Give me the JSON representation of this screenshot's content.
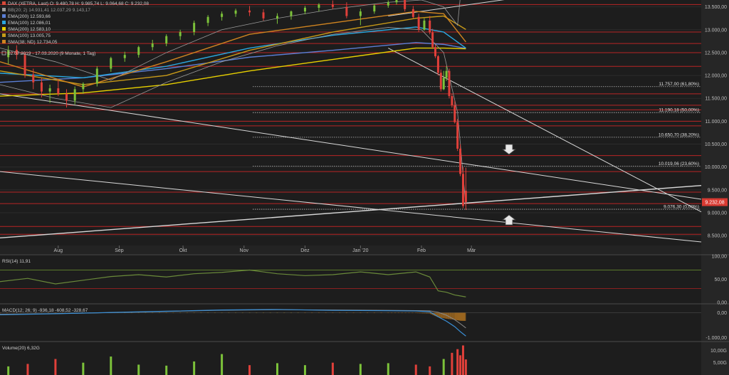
{
  "header": {
    "dax": "DAX (XETRA, Last)  O: 9.480,78  H: 9.985,74  L: 9.064,68  C: 9.232,08",
    "bb": "BB(20; 2)  14.931,41  12.037,29  9.143,17",
    "ema200": "EMA(200)  12.593,66",
    "ema100": "EMA(100)  12.086,01",
    "sma200": "SMA(200)  12.583,10",
    "sma100": "SMA(100)  13.005,75",
    "sma38": "SMA(38; ND)  12.734,05",
    "range": "02.07.2019 - 17.03.2020  (9 Monate, 1 Tag)"
  },
  "price_label": "9.232,08",
  "colors": {
    "up": "#7cc23a",
    "down": "#e0403a",
    "ema200": "#5b7fd6",
    "ema100": "#2aa8e0",
    "sma200": "#e8d000",
    "sma100": "#c89a18",
    "sma38": "#d08420",
    "bb": "#9a9a9a",
    "resistance": "#b82525",
    "trend": "#d8d8d8",
    "rsi": "#6a8a3a",
    "macd": "#3a8fd6",
    "signal": "#8a8a8a"
  },
  "fib_labels": [
    "11.757,00 (61,80%)",
    "11.190,18 (50,00%)",
    "10.650,70 (38,20%)",
    "10.019,06 (23,60%)",
    "9.076,30 (0,00%)"
  ],
  "rsi_header": "RSI(14)  11,91",
  "macd_header": "MACD(12; 26; 9)  -936,18  -608,52  -328,67",
  "vol_header": "Volume(20)  6,32G",
  "icons": {
    "down_arrow": "down-arrow-icon",
    "up_arrow": "up-arrow-icon"
  },
  "chart_data": [
    {
      "type": "candlestick",
      "name": "DAX (XETRA, Last)",
      "y_axis_ticks": [
        "13.500,00",
        "13.000,00",
        "12.500,00",
        "12.000,00",
        "11.500,00",
        "11.000,00",
        "10.500,00",
        "10.000,00",
        "9.500,00",
        "9.000,00",
        "8.500,00"
      ],
      "y_ticks": [
        13500,
        13000,
        12500,
        12000,
        11500,
        11000,
        10500,
        10000,
        9500,
        9000,
        8500
      ],
      "ylim": [
        8300,
        13650
      ],
      "x_axis_labels": [
        "Aug",
        "Sep",
        "Okt",
        "Nov",
        "Dez",
        "Jan '20",
        "Feb",
        "Mär"
      ],
      "x_label_index": [
        21,
        43,
        66,
        88,
        110,
        130,
        152,
        170
      ],
      "ohlc": [
        [
          12400,
          12650,
          12250,
          12550
        ],
        [
          12560,
          12660,
          12350,
          12450
        ],
        [
          12450,
          12500,
          11950,
          12020
        ],
        [
          12020,
          12150,
          11700,
          11850
        ],
        [
          11850,
          11950,
          11520,
          11650
        ],
        [
          11650,
          11800,
          11400,
          11720
        ],
        [
          11720,
          11900,
          11550,
          11600
        ],
        [
          11600,
          11700,
          11300,
          11450
        ],
        [
          11450,
          11760,
          11370,
          11700
        ],
        [
          11700,
          11850,
          11600,
          11820
        ],
        [
          11820,
          12200,
          11760,
          12150
        ],
        [
          12150,
          12410,
          12080,
          12380
        ],
        [
          12380,
          12520,
          12300,
          12450
        ],
        [
          12450,
          12650,
          12390,
          12620
        ],
        [
          12620,
          12780,
          12550,
          12700
        ],
        [
          12700,
          12900,
          12640,
          12860
        ],
        [
          12860,
          13000,
          12780,
          12950
        ],
        [
          12950,
          13200,
          12880,
          13150
        ],
        [
          13150,
          13320,
          13080,
          13280
        ],
        [
          13280,
          13400,
          13200,
          13350
        ],
        [
          13350,
          13460,
          13280,
          13420
        ],
        [
          13420,
          13520,
          13300,
          13380
        ],
        [
          13380,
          13450,
          13200,
          13250
        ],
        [
          13250,
          13360,
          13130,
          13300
        ],
        [
          13300,
          13420,
          13220,
          13400
        ],
        [
          13400,
          13520,
          13340,
          13480
        ],
        [
          13480,
          13580,
          13400,
          13550
        ],
        [
          13550,
          13640,
          13450,
          13500
        ],
        [
          13500,
          13600,
          13250,
          13300
        ],
        [
          13300,
          13460,
          13100,
          13400
        ],
        [
          13400,
          13560,
          13350,
          13530
        ],
        [
          13530,
          13640,
          13480,
          13600
        ],
        [
          13600,
          13700,
          13550,
          13650
        ],
        [
          13650,
          13700,
          13400,
          13450
        ],
        [
          13450,
          13520,
          13250,
          13280
        ],
        [
          13280,
          13350,
          12950,
          13000
        ],
        [
          13000,
          13250,
          12980,
          13200
        ],
        [
          13200,
          13300,
          12900,
          12940
        ],
        [
          12940,
          13020,
          12580,
          12620
        ],
        [
          12620,
          12680,
          12380,
          12420
        ],
        [
          12420,
          12450,
          12000,
          12060
        ],
        [
          12060,
          12130,
          11650,
          11700
        ],
        [
          11700,
          12100,
          11680,
          11950
        ],
        [
          11950,
          12200,
          11880,
          12100
        ],
        [
          12100,
          12150,
          11500,
          11550
        ],
        [
          11550,
          11600,
          11300,
          11350
        ],
        [
          11350,
          11450,
          10950,
          10980
        ],
        [
          10980,
          11050,
          10350,
          10400
        ],
        [
          10400,
          10500,
          9800,
          9850
        ],
        [
          9850,
          10000,
          9100,
          9150
        ],
        [
          9480,
          9985,
          9064,
          9232
        ]
      ],
      "bar_index": [
        3,
        6,
        9,
        12,
        15,
        18,
        21,
        24,
        27,
        30,
        35,
        40,
        45,
        50,
        55,
        60,
        65,
        70,
        75,
        80,
        85,
        90,
        95,
        100,
        105,
        110,
        115,
        120,
        125,
        130,
        135,
        140,
        143,
        146,
        149,
        151,
        153,
        155,
        156,
        157,
        158,
        159,
        160,
        161,
        162,
        163,
        164,
        165,
        166,
        167,
        168
      ],
      "series": [
        {
          "name": "EMA(200)",
          "x": [
            0,
            30,
            60,
            90,
            120,
            150,
            160,
            168
          ],
          "values": [
            11850,
            11950,
            12150,
            12400,
            12550,
            12720,
            12680,
            12594
          ]
        },
        {
          "name": "EMA(100)",
          "x": [
            0,
            30,
            60,
            90,
            120,
            150,
            160,
            168
          ],
          "values": [
            12050,
            11950,
            12200,
            12600,
            12880,
            13060,
            12950,
            12600
          ]
        },
        {
          "name": "SMA(200)",
          "x": [
            0,
            30,
            60,
            90,
            120,
            150,
            160,
            168
          ],
          "values": [
            11550,
            11620,
            11800,
            12100,
            12350,
            12600,
            12600,
            12583
          ]
        },
        {
          "name": "SMA(100)",
          "x": [
            0,
            30,
            60,
            90,
            120,
            150,
            160,
            168
          ],
          "values": [
            12100,
            11800,
            12000,
            12550,
            12950,
            13250,
            13300,
            13006
          ]
        },
        {
          "name": "SMA(38; ND)",
          "x": [
            0,
            30,
            60,
            90,
            120,
            150,
            160,
            168
          ],
          "values": [
            12300,
            11750,
            12300,
            12900,
            13150,
            13400,
            13350,
            12734
          ]
        },
        {
          "name": "BB(20; 2) upper",
          "x": [
            0,
            20,
            40,
            60,
            80,
            100,
            120,
            140,
            152,
            160,
            165,
            168
          ],
          "values": [
            12600,
            12300,
            11900,
            12500,
            13000,
            13250,
            13450,
            13600,
            13650,
            13500,
            13100,
            14931
          ]
        },
        {
          "name": "BB(20; 2) lower",
          "x": [
            0,
            20,
            40,
            60,
            80,
            100,
            120,
            140,
            152,
            160,
            165,
            168
          ],
          "values": [
            11800,
            11500,
            11300,
            11850,
            12300,
            12650,
            12900,
            13050,
            13000,
            12500,
            11200,
            9143
          ]
        }
      ],
      "resistance_levels": [
        13550,
        12950,
        12700,
        12500,
        12200,
        11600,
        11350,
        11250,
        11000,
        10900,
        10250,
        9900,
        9450,
        9200,
        8700,
        8530
      ],
      "fibonacci_levels": [
        11757,
        11190.18,
        10650.7,
        10019.06,
        9076.3
      ],
      "trendlines": [
        {
          "from": [
            0,
            11600
          ],
          "to": [
            181,
            9950
          ]
        },
        {
          "from": [
            0,
            9900
          ],
          "to": [
            181,
            8800
          ]
        },
        {
          "from": [
            0,
            8450
          ],
          "to": [
            181,
            9270
          ]
        },
        {
          "from": [
            140,
            13300
          ],
          "to": [
            181,
            13650
          ]
        },
        {
          "from": [
            140,
            12600
          ],
          "to": [
            181,
            11300
          ]
        }
      ],
      "x_range": [
        0,
        181
      ],
      "last_close": 9232.08
    },
    {
      "type": "line",
      "name": "RSI(14)",
      "value": 11.91,
      "y_axis_ticks": [
        "100,00",
        "50,00",
        "0,00"
      ],
      "ylim": [
        0,
        100
      ],
      "levels": [
        70,
        30
      ],
      "x": [
        0,
        10,
        20,
        30,
        40,
        50,
        60,
        70,
        80,
        90,
        100,
        110,
        120,
        130,
        140,
        150,
        155,
        158,
        161,
        164,
        166,
        168
      ],
      "values": [
        45,
        52,
        40,
        48,
        56,
        60,
        55,
        62,
        65,
        70,
        62,
        58,
        60,
        66,
        60,
        66,
        55,
        25,
        22,
        16,
        14,
        11.91
      ]
    },
    {
      "type": "line",
      "name": "MACD(12; 26; 9)",
      "y_axis_ticks": [
        "0,00",
        "-1.000,00"
      ],
      "ylim": [
        -1100,
        300
      ],
      "x": [
        0,
        20,
        40,
        60,
        80,
        100,
        120,
        140,
        150,
        155,
        158,
        161,
        164,
        166,
        168
      ],
      "values": [
        -80,
        -40,
        10,
        60,
        110,
        130,
        95,
        80,
        70,
        40,
        -160,
        -340,
        -560,
        -760,
        -936.18
      ],
      "signal": [
        -60,
        -35,
        5,
        50,
        100,
        120,
        110,
        95,
        85,
        75,
        20,
        -100,
        -280,
        -440,
        -608.52
      ],
      "histogram": [
        -328.67
      ]
    },
    {
      "type": "bar",
      "name": "Volume(20)",
      "y_axis_ticks": [
        "10,00G",
        "5,00G"
      ],
      "ylim": [
        0,
        13
      ],
      "x": [
        3,
        10,
        20,
        30,
        40,
        50,
        60,
        70,
        80,
        90,
        100,
        110,
        120,
        130,
        140,
        150,
        155,
        160,
        163,
        165,
        166,
        167,
        168
      ],
      "values": [
        3.5,
        4.5,
        6.5,
        5.0,
        7.5,
        4.2,
        3.8,
        5.5,
        8.5,
        4.0,
        4.8,
        4.0,
        5.0,
        4.5,
        4.8,
        4.2,
        3.5,
        6.5,
        9.0,
        10.5,
        8.0,
        12.0,
        6.32
      ]
    }
  ]
}
